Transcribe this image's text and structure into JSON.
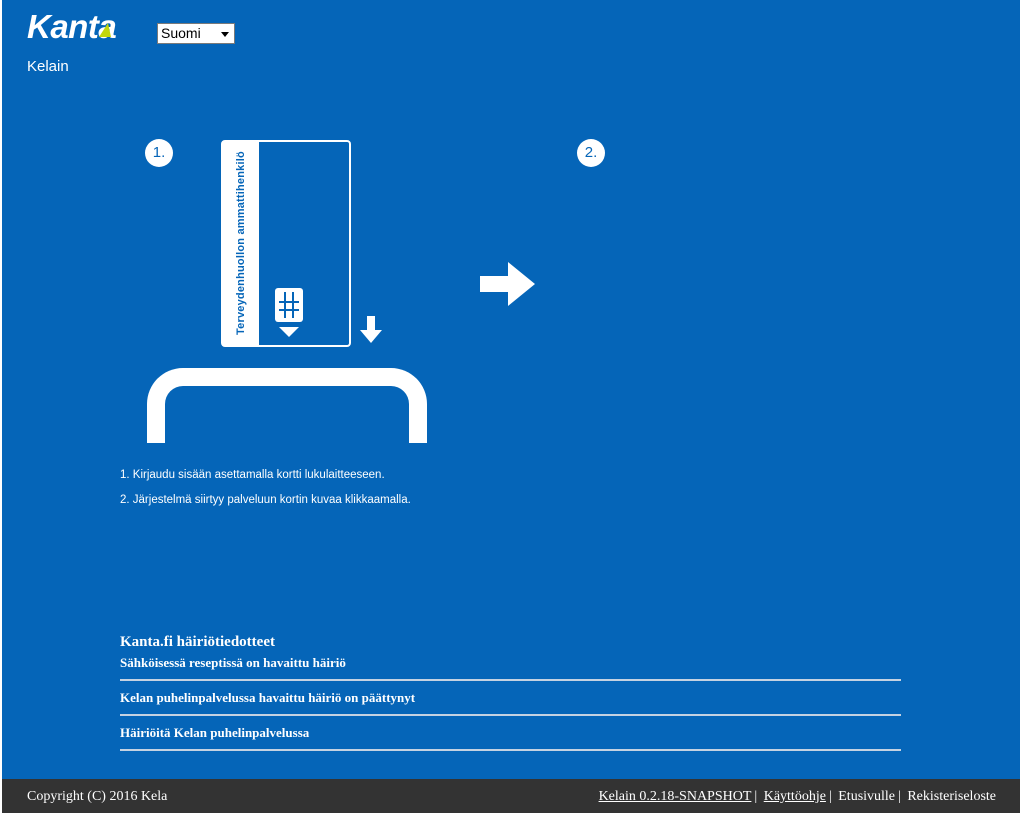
{
  "header": {
    "logo_text": "Kanta",
    "app_name": "Kelain",
    "language": {
      "selected": "Suomi"
    }
  },
  "steps": {
    "step1_label": "1.",
    "step2_label": "2.",
    "card_text": "Terveydenhuollon ammattihenkilö"
  },
  "instructions": [
    "1. Kirjaudu sisään asettamalla kortti lukulaitteeseen.",
    "2. Järjestelmä siirtyy palveluun kortin kuvaa klikkaamalla."
  ],
  "notices": {
    "title": "Kanta.fi häiriötiedotteet",
    "items": [
      "Sähköisessä reseptissä on havaittu häiriö",
      "Kelan puhelinpalvelussa havaittu häiriö on päättynyt",
      "Häiriöitä Kelan puhelinpalvelussa"
    ]
  },
  "footer": {
    "copyright": "Copyright (C) 2016 Kela",
    "version": "Kelain 0.2.18-SNAPSHOT",
    "help": "Käyttöohje",
    "home": "Etusivulle",
    "privacy": "Rekisteriseloste",
    "separator": "|"
  },
  "colors": {
    "background": "#0565b8",
    "footer": "#333333",
    "logo_accent": "#c2d60c"
  },
  "icons": [
    "card-chip-icon",
    "down-arrow-icon",
    "right-arrow-icon",
    "dropdown-caret-icon"
  ]
}
